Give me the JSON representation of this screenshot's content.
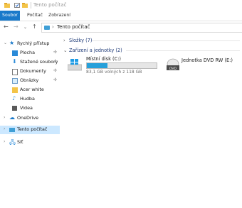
{
  "window": {
    "title": "Tento počítač"
  },
  "ribbon": {
    "tabs": [
      "Soubor",
      "Počítač",
      "Zobrazení"
    ]
  },
  "address": {
    "path": "Tento počítač"
  },
  "nav": {
    "quick_access": "Rychlý přístup",
    "quick_items": [
      "Plocha",
      "Stažené soubory",
      "Dokumenty",
      "Obrázky",
      "Acer white",
      "Hudba",
      "Videa"
    ],
    "onedrive": "OneDrive",
    "this_pc": "Tento počítač",
    "network": "Síť"
  },
  "main": {
    "folders_header": "Složky (7)",
    "devices_header": "Zařízení a jednotky (2)",
    "drives": [
      {
        "name": "Místní disk (C:)",
        "space": "83,1 GB volných z 118 GB",
        "used_fraction": 0.3
      },
      {
        "name": "Jednotka DVD RW (E:)",
        "icon_label": "DVD"
      }
    ]
  },
  "colors": {
    "accent": "#1979ca",
    "selection": "#cce8ff",
    "drive_bar": "#26a0da"
  }
}
